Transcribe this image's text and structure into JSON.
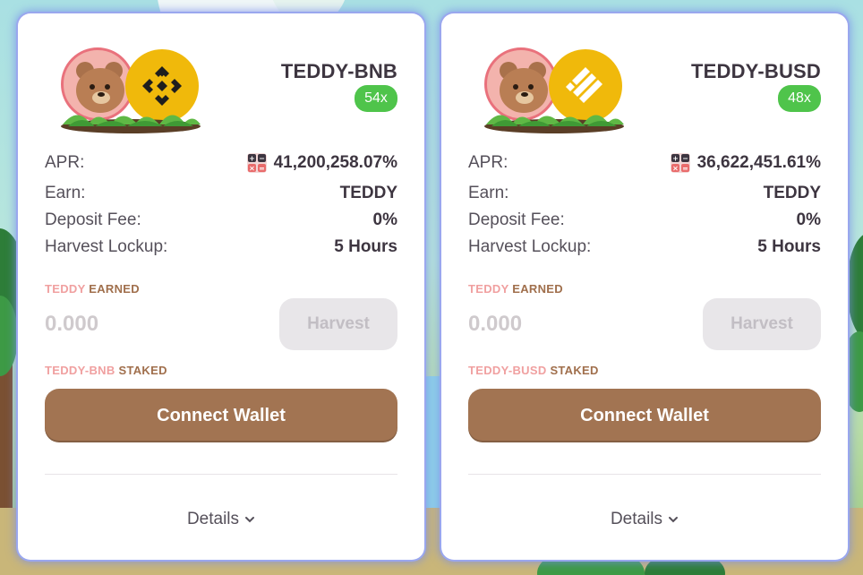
{
  "farms": [
    {
      "pair": "TEDDY-BNB",
      "multiplier": "54x",
      "apr_label": "APR:",
      "apr_value": "41,200,258.07%",
      "earn_label": "Earn:",
      "earn_value": "TEDDY",
      "deposit_fee_label": "Deposit Fee:",
      "deposit_fee_value": "0%",
      "harvest_lockup_label": "Harvest Lockup:",
      "harvest_lockup_value": "5 Hours",
      "earned_token": "TEDDY",
      "earned_suffix": "EARNED",
      "earned_amount": "0.000",
      "harvest_label": "Harvest",
      "staked_token": "TEDDY-BNB",
      "staked_suffix": "STAKED",
      "connect_label": "Connect Wallet",
      "details_label": "Details",
      "quote_token_icon": "bnb-icon"
    },
    {
      "pair": "TEDDY-BUSD",
      "multiplier": "48x",
      "apr_label": "APR:",
      "apr_value": "36,622,451.61%",
      "earn_label": "Earn:",
      "earn_value": "TEDDY",
      "deposit_fee_label": "Deposit Fee:",
      "deposit_fee_value": "0%",
      "harvest_lockup_label": "Harvest Lockup:",
      "harvest_lockup_value": "5 Hours",
      "earned_token": "TEDDY",
      "earned_suffix": "EARNED",
      "earned_amount": "0.000",
      "harvest_label": "Harvest",
      "staked_token": "TEDDY-BUSD",
      "staked_suffix": "STAKED",
      "connect_label": "Connect Wallet",
      "details_label": "Details",
      "quote_token_icon": "busd-icon"
    }
  ],
  "colors": {
    "multiplier_badge": "#4fc44b",
    "connect_button": "#a27452",
    "label_brown": "#a06f4c",
    "label_pink": "#f0a0a0",
    "card_glow": "#9aa7ee"
  }
}
